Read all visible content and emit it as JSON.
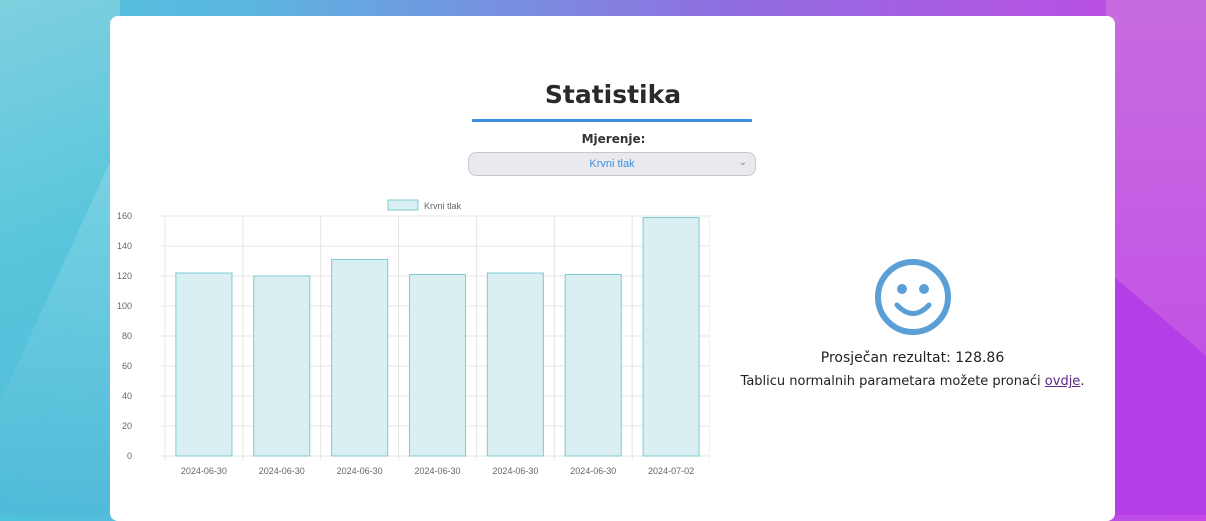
{
  "page": {
    "title": "Statistika",
    "measurement_label": "Mjerenje:",
    "measurement_select": {
      "selected": "Krvni tlak"
    }
  },
  "colors": {
    "accent": "#3d8fe0",
    "bar_fill": "#d9eff2",
    "bar_stroke": "#7ecbd3",
    "smiley": "#4a90d9",
    "link": "#5b2a86"
  },
  "chart_data": {
    "type": "bar",
    "categories": [
      "2024-06-30",
      "2024-06-30",
      "2024-06-30",
      "2024-06-30",
      "2024-06-30",
      "2024-06-30",
      "2024-07-02"
    ],
    "series": [
      {
        "name": "Krvni tlak",
        "values": [
          122,
          120,
          131,
          121,
          122,
          121,
          159
        ]
      }
    ],
    "ylim": [
      0,
      160
    ],
    "yticks": [
      0,
      20,
      40,
      60,
      80,
      100,
      120,
      140,
      160
    ],
    "legend": "top-center",
    "grid": true
  },
  "result": {
    "smiley_icon": "smiley-face-icon",
    "average_text": "Prosječan rezultat: 128.86",
    "note_prefix": "Tablicu normalnih parametara možete pronaći ",
    "note_link": "ovdje",
    "note_suffix": "."
  }
}
